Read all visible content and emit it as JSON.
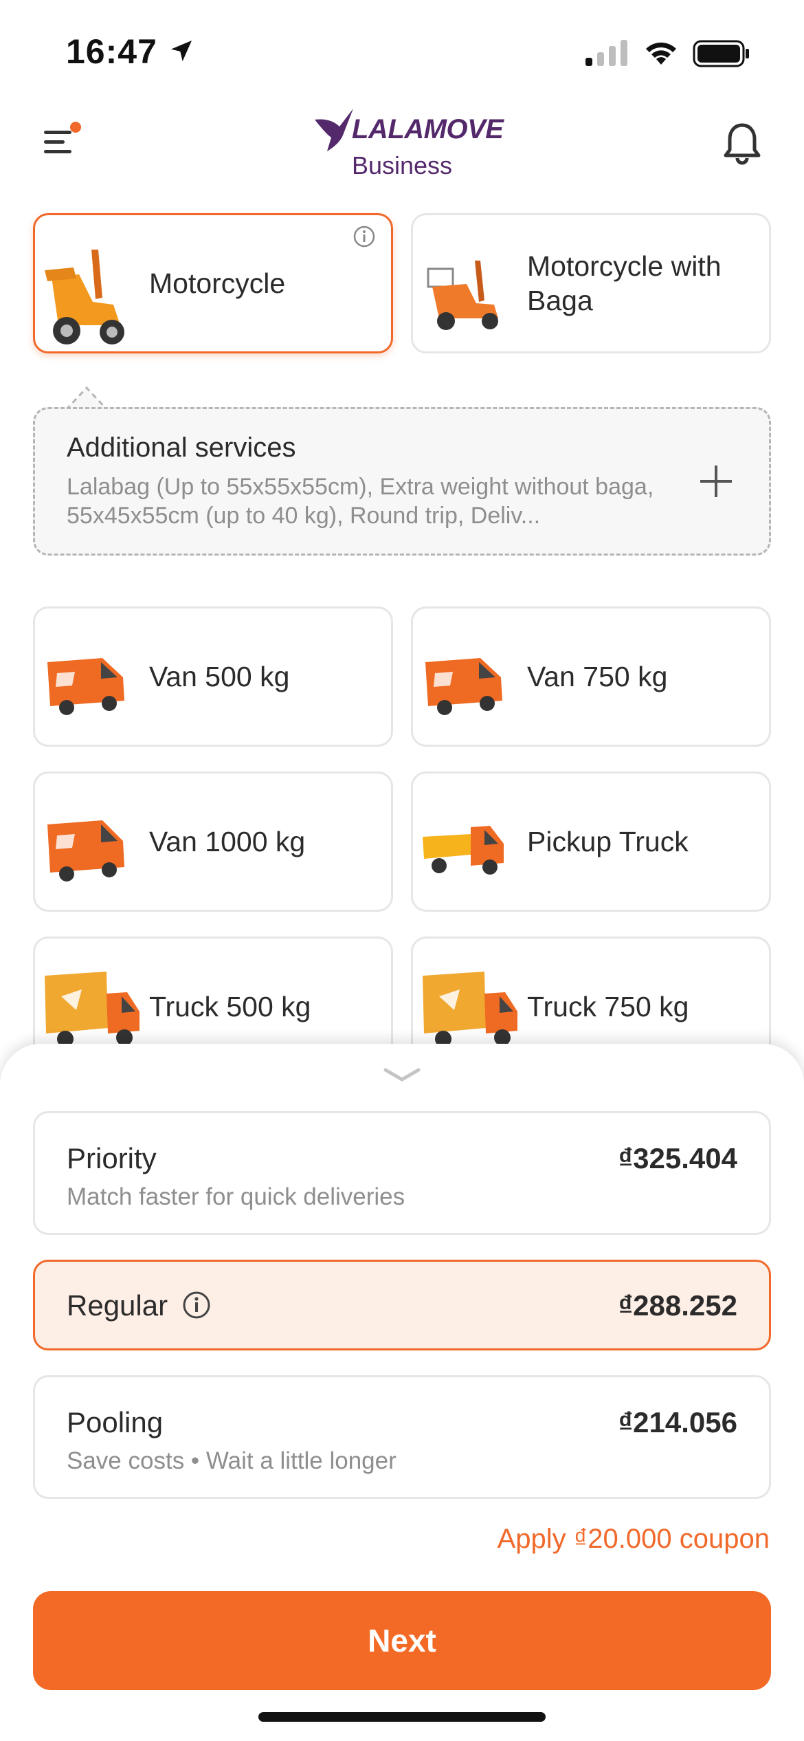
{
  "status_bar": {
    "time": "16:47"
  },
  "header": {
    "brand": "LALAMOVE",
    "brand_sub": "Business"
  },
  "vehicles": [
    {
      "label": "Motorcycle",
      "selected": true
    },
    {
      "label": "Motorcycle with Baga",
      "selected": false
    },
    {
      "label": "Van 500 kg",
      "selected": false
    },
    {
      "label": "Van 750 kg",
      "selected": false
    },
    {
      "label": "Van 1000 kg",
      "selected": false
    },
    {
      "label": "Pickup Truck",
      "selected": false
    },
    {
      "label": "Truck 500 kg",
      "selected": false
    },
    {
      "label": "Truck 750 kg",
      "selected": false
    }
  ],
  "additional_services": {
    "title": "Additional services",
    "description": "Lalabag (Up to 55x55x55cm), Extra weight without baga, 55x45x55cm (up to 40 kg), Round trip, Deliv..."
  },
  "delivery_options": [
    {
      "name": "Priority",
      "price": "₫325.404",
      "subtitle": "Match faster for quick deliveries",
      "selected": false
    },
    {
      "name": "Regular",
      "price": "₫288.252",
      "subtitle": "",
      "selected": true
    },
    {
      "name": "Pooling",
      "price": "₫214.056",
      "subtitle": "Save costs • Wait a little longer",
      "selected": false
    }
  ],
  "coupon_link": "Apply ₫20.000 coupon",
  "next_button": "Next",
  "colors": {
    "accent": "#f26a25",
    "brand": "#54296b",
    "selected_bg": "#fdeee6"
  }
}
